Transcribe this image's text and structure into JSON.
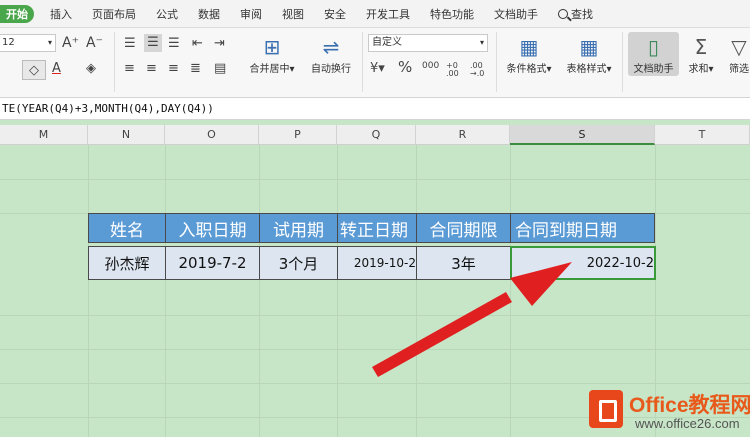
{
  "menu": {
    "start": "开始",
    "items": [
      "插入",
      "页面布局",
      "公式",
      "数据",
      "审阅",
      "视图",
      "安全",
      "开发工具",
      "特色功能",
      "文档助手"
    ],
    "search": "查找"
  },
  "ribbon": {
    "font_size": "12",
    "font_grow": "A⁺",
    "font_shrink": "A⁻",
    "merge_label": "合并居中",
    "wrap_label": "自动换行",
    "number_format": "自定义",
    "percent": "%",
    "thousands": "000",
    "dec_inc": "+0 .00",
    "dec_dec": ".00 →.0",
    "cond_format_label": "条件格式",
    "table_style_label": "表格样式",
    "doc_helper_label": "文档助手",
    "sum_label": "求和",
    "filter_label": "筛选"
  },
  "formula_bar": {
    "text": "TE(YEAR(Q4)+3,MONTH(Q4),DAY(Q4))"
  },
  "columns": [
    "M",
    "N",
    "O",
    "P",
    "Q",
    "R",
    "S",
    "T"
  ],
  "selected_column": "S",
  "table": {
    "headers": [
      "姓名",
      "入职日期",
      "试用期",
      "转正日期",
      "合同期限",
      "合同到期日期"
    ],
    "row": [
      "孙杰辉",
      "2019-7-2",
      "3个月",
      "2019-10-2",
      "3年",
      "2022-10-2"
    ]
  },
  "logo": {
    "brand": "Office教程网",
    "url": "www.office26.com"
  },
  "colors": {
    "sheet_bg": "#c7e5c7",
    "header_fill": "#5b9bd5",
    "data_fill": "#dde6f0",
    "arrow": "#e02020",
    "selection": "#3a9a3a"
  }
}
